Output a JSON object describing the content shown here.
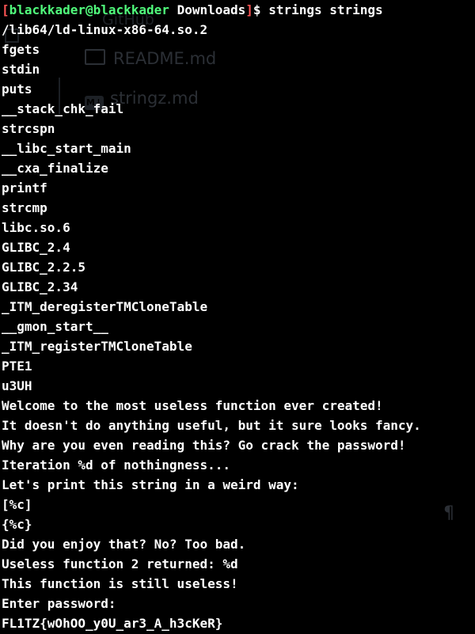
{
  "prompt": {
    "open_bracket": "[",
    "user_host": "blackkader@blackkader",
    "space": " ",
    "directory": "Downloads",
    "close_bracket": "]",
    "symbol": "$ ",
    "command": "strings strings"
  },
  "background_window": {
    "github_label": "GitHub",
    "file_1": "README.md",
    "file_2": "stringz.md",
    "pilcrow": "¶"
  },
  "output_lines": [
    "/lib64/ld-linux-x86-64.so.2",
    "fgets",
    "stdin",
    "puts",
    "__stack_chk_fail",
    "strcspn",
    "__libc_start_main",
    "__cxa_finalize",
    "printf",
    "strcmp",
    "libc.so.6",
    "GLIBC_2.4",
    "GLIBC_2.2.5",
    "GLIBC_2.34",
    "_ITM_deregisterTMCloneTable",
    "__gmon_start__",
    "_ITM_registerTMCloneTable",
    "PTE1",
    "u3UH",
    "Welcome to the most useless function ever created!",
    "It doesn't do anything useful, but it sure looks fancy.",
    "Why are you even reading this? Go crack the password!",
    "Iteration %d of nothingness...",
    "Let's print this string in a weird way:",
    "[%c]",
    "{%c}",
    "Did you enjoy that? No? Too bad.",
    "Useless function 2 returned: %d",
    "This function is still useless!",
    "Enter password:",
    "FL1TZ{wOhOO_y0U_ar3_A_h3cKeR}"
  ],
  "colors": {
    "background": "#000000",
    "text": "#ffffff",
    "prompt_bracket": "#ff5555",
    "prompt_user": "#50fa7b"
  }
}
